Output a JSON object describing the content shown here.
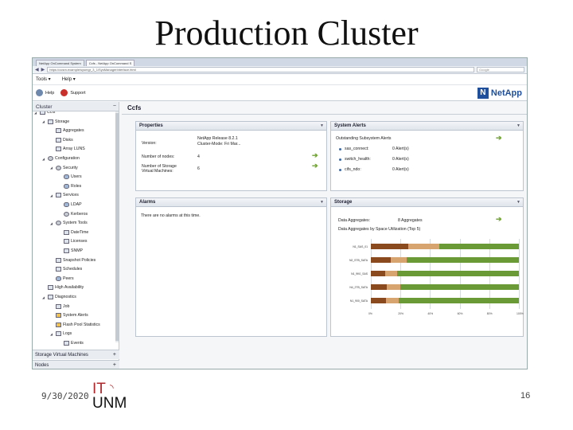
{
  "slide": {
    "title": "Production Cluster",
    "date": "9/30/2020",
    "page_number": "16",
    "logo_top": "IT",
    "logo_bottom": "UNM",
    "logo_color": "#b0272b"
  },
  "browser": {
    "tabs": [
      {
        "label": "NetApp OnCommand System",
        "active": false
      },
      {
        "label": "Ccfs - NetApp OnCommand S",
        "active": true
      }
    ],
    "url": "https://ocsm.example/sysmgr_3_1/SysManagerInterface.html",
    "search_placeholder": "Google"
  },
  "menubar": {
    "tools": "Tools ▾",
    "help": "Help ▾"
  },
  "toolbar": {
    "help": "Help",
    "support": "Support",
    "logo_text": "NetApp"
  },
  "tree": {
    "header": "Cluster",
    "items": [
      {
        "label": "Ccfs",
        "level": 0,
        "icon": "cluster-icon",
        "expand": "◢"
      },
      {
        "label": "Storage",
        "level": 1,
        "icon": "storage-icon",
        "expand": "◢"
      },
      {
        "label": "Aggregates",
        "level": 2,
        "icon": "aggregates-icon",
        "expand": ""
      },
      {
        "label": "Disks",
        "level": 2,
        "icon": "disks-icon",
        "expand": ""
      },
      {
        "label": "Array LUNS",
        "level": 2,
        "icon": "array-luns-icon",
        "expand": ""
      },
      {
        "label": "Configuration",
        "level": 1,
        "icon": "configuration-icon",
        "expand": "◢"
      },
      {
        "label": "Security",
        "level": 2,
        "icon": "security-icon",
        "expand": "◢"
      },
      {
        "label": "Users",
        "level": 3,
        "icon": "users-icon",
        "expand": ""
      },
      {
        "label": "Roles",
        "level": 3,
        "icon": "roles-icon",
        "expand": ""
      },
      {
        "label": "Services",
        "level": 2,
        "icon": "services-icon",
        "expand": "◢"
      },
      {
        "label": "LDAP",
        "level": 3,
        "icon": "ldap-icon",
        "expand": ""
      },
      {
        "label": "Kerberos",
        "level": 3,
        "icon": "kerberos-icon",
        "expand": ""
      },
      {
        "label": "System Tools",
        "level": 2,
        "icon": "system-tools-icon",
        "expand": "◢"
      },
      {
        "label": "DateTime",
        "level": 3,
        "icon": "datetime-icon",
        "expand": ""
      },
      {
        "label": "Licenses",
        "level": 3,
        "icon": "licenses-icon",
        "expand": ""
      },
      {
        "label": "SNMP",
        "level": 3,
        "icon": "snmp-icon",
        "expand": ""
      },
      {
        "label": "Snapshot Policies",
        "level": 2,
        "icon": "snapshot-policies-icon",
        "expand": ""
      },
      {
        "label": "Schedules",
        "level": 2,
        "icon": "schedules-icon",
        "expand": ""
      },
      {
        "label": "Peers",
        "level": 2,
        "icon": "peers-icon",
        "expand": ""
      },
      {
        "label": "High Availability",
        "level": 1,
        "icon": "high-availability-icon",
        "expand": ""
      },
      {
        "label": "Diagnostics",
        "level": 1,
        "icon": "diagnostics-icon",
        "expand": "◢"
      },
      {
        "label": "Job",
        "level": 2,
        "icon": "job-icon",
        "expand": ""
      },
      {
        "label": "System Alerts",
        "level": 2,
        "icon": "system-alerts-icon",
        "expand": ""
      },
      {
        "label": "Flash Pool Statistics",
        "level": 2,
        "icon": "flash-pool-icon",
        "expand": ""
      },
      {
        "label": "Logs",
        "level": 2,
        "icon": "logs-icon",
        "expand": "◢"
      },
      {
        "label": "Events",
        "level": 3,
        "icon": "events-icon",
        "expand": ""
      }
    ],
    "footer_svm": "Storage Virtual Machines",
    "footer_nodes": "Nodes"
  },
  "main": {
    "title": "Ccfs",
    "properties": {
      "title": "Properties",
      "rows": [
        {
          "label": "Version:",
          "value": "NetApp Release 8.2.1\nCluster-Mode: Fri Mar..."
        },
        {
          "label": "Number of nodes:",
          "value": "4"
        },
        {
          "label": "Number of Storage\nVirtual Machines:",
          "value": "6"
        }
      ]
    },
    "system_alerts": {
      "title": "System Alerts",
      "heading": "Outstanding Subsystem Alerts",
      "rows": [
        {
          "name": "sas_connect:",
          "count": "0 Alert(s)"
        },
        {
          "name": "switch_health:",
          "count": "0 Alert(s)"
        },
        {
          "name": "cifs_ndo:",
          "count": "0 Alert(s)"
        }
      ]
    },
    "alarms": {
      "title": "Alarms",
      "text": "There are no alarms at this time."
    },
    "storage": {
      "title": "Storage",
      "data_aggregates_label": "Data Aggregates:",
      "data_aggregates_value": "8 Aggregates",
      "chart_caption": "Data Aggregates by Space Utilization (Top 5)"
    }
  },
  "chart_data": {
    "type": "bar",
    "title": "Data Aggregates by Space Utilization (Top 5)",
    "categories": [
      "N1_SAS_01",
      "N2_STB_SATA",
      "N1_9K0_SAS",
      "N4_2TB_SATA",
      "N1_900_SATA"
    ],
    "series": [
      {
        "values": [
          46,
          24,
          18,
          20,
          19
        ]
      },
      {
        "values": [
          54,
          76,
          82,
          80,
          81
        ]
      }
    ],
    "xlim": [
      0,
      100
    ],
    "x_ticks": [
      "0%",
      "20%",
      "40%",
      "60%",
      "80%",
      "100%"
    ],
    "colors": {
      "used_dark": "#8a4a1e",
      "used_light": "#d7a36e",
      "free": "#6a9a36"
    },
    "orientation": "horizontal"
  }
}
